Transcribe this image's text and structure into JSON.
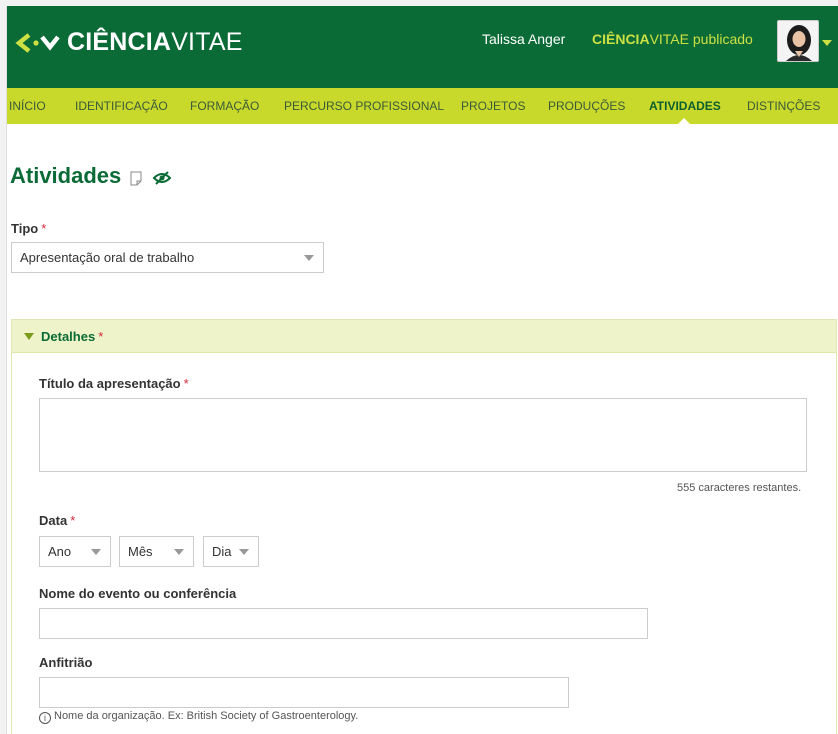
{
  "header": {
    "logo_bold": "CIÊNCIA",
    "logo_light": "VITAE",
    "user_name": "Talissa Anger",
    "published_bold": "CIÊNCIA",
    "published_light": "VITAE publicado",
    "colors": {
      "header_bg": "#0b6b36",
      "nav_bg": "#c8d92b",
      "accent": "#cde043"
    }
  },
  "nav": {
    "items": [
      "INÍCIO",
      "IDENTIFICAÇÃO",
      "FORMAÇÃO",
      "PERCURSO PROFISSIONAL",
      "PROJETOS",
      "PRODUÇÕES",
      "ATIVIDADES",
      "DISTINÇÕES"
    ],
    "active": "ATIVIDADES"
  },
  "page": {
    "title": "Atividades",
    "icons": [
      "note-icon",
      "eye-slash-icon"
    ]
  },
  "form": {
    "tipo_label": "Tipo",
    "required_mark": "*",
    "tipo_value": "Apresentação oral de trabalho",
    "section_title": "Detalhes",
    "titulo_label": "Título da apresentação",
    "titulo_value": "",
    "chars_remaining": "555 caracteres restantes.",
    "data_label": "Data",
    "ano": "Ano",
    "mes": "Mês",
    "dia": "Dia",
    "evento_label": "Nome do evento ou conferência",
    "evento_value": "",
    "anfitriao_label": "Anfitrião",
    "anfitriao_value": "",
    "anfitriao_hint": "Nome da organização. Ex: British Society of Gastroenterology."
  }
}
